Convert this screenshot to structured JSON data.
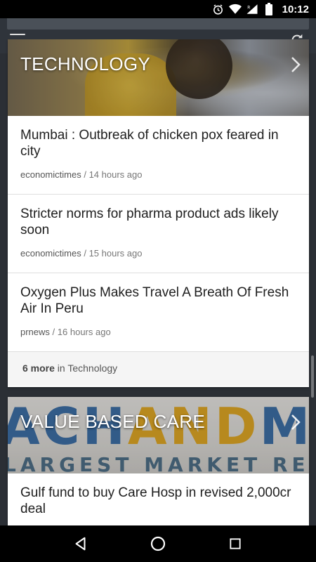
{
  "status": {
    "time": "10:12"
  },
  "sections": [
    {
      "title": "TECHNOLOGY",
      "articles": [
        {
          "title": "Mumbai : Outbreak of chicken pox feared in city",
          "source": "economictimes",
          "time": "14 hours ago"
        },
        {
          "title": "Stricter norms for pharma product ads likely soon",
          "source": "economictimes",
          "time": "15 hours ago"
        },
        {
          "title": "Oxygen Plus Makes Travel A Breath Of Fresh Air In Peru",
          "source": "prnews",
          "time": "16 hours ago"
        }
      ],
      "more": {
        "count": "6 more",
        "label": " in Technology"
      }
    },
    {
      "title": "VALUE BASED CARE",
      "banner_text_1": "ACH",
      "banner_text_2": "AND",
      "banner_text_3": "MA",
      "banner_sub": "LARGEST MARKET RE",
      "articles": [
        {
          "title": "Gulf fund to buy Care Hosp in revised 2,000cr deal"
        }
      ]
    }
  ],
  "colors": {
    "status_bar": "#000000",
    "nav_bar": "#000000",
    "feed_background": "#2b2f35",
    "card_background": "#ffffff"
  }
}
